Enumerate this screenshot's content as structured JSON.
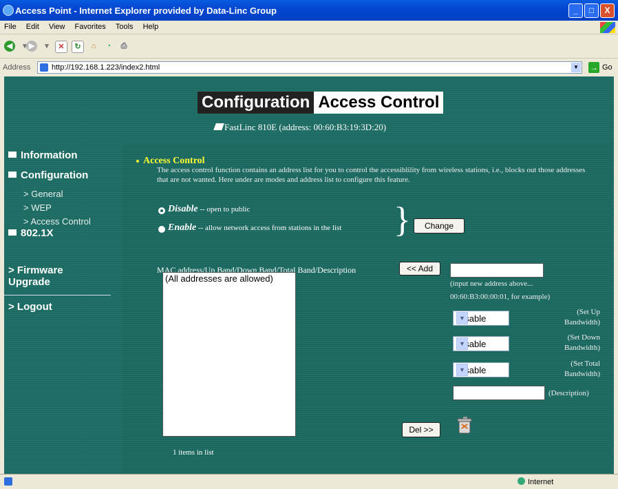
{
  "window": {
    "title": "Access Point - Internet Explorer provided by Data-Linc Group",
    "min": "_",
    "max": "□",
    "close": "X"
  },
  "menu": [
    "File",
    "Edit",
    "View",
    "Favorites",
    "Tools",
    "Help"
  ],
  "address_bar": {
    "label": "Address",
    "url": "http://192.168.1.223/index2.html",
    "go_label": "Go"
  },
  "page": {
    "banner_config": "Configuration",
    "banner_section": "Access Control",
    "device": "FastLinc 810E (address: 00:60:B3:19:3D:20)"
  },
  "sidebar": {
    "information": "Information",
    "configuration": "Configuration",
    "general": "> General",
    "wep": "> WEP",
    "access_control": "> Access Control",
    "dot1x": "802.1X",
    "firmware_1": "> Firmware",
    "firmware_2": "Upgrade",
    "logout": "> Logout"
  },
  "access_control": {
    "title": "Access Control",
    "description": "The access control function contains an address list for you to control the accessiblility from wireless stations, i.e., blocks out those addresses that are not wanted. Here under are modes and address list to configure this feature.",
    "mode_disable_label": "Disable",
    "mode_disable_desc": "-- open to public",
    "mode_enable_label": "Enable",
    "mode_enable_desc": "-- allow network access from stations in the list",
    "selected_mode": "Disable",
    "change_button": "Change",
    "list_label": "MAC address/Up Band/Down Band/Total Band/Description",
    "list_items": [
      "(All addresses are allowed)"
    ],
    "add_button": "<< Add",
    "new_address_value": "",
    "hint_1": "(input new address above...",
    "hint_2": "00:60:B3:00:00:01, for example)",
    "up_bw": {
      "value": "Disable",
      "label_1": "(Set Up",
      "label_2": "Bandwidth)"
    },
    "down_bw": {
      "value": "Disable",
      "label_1": "(Set Down",
      "label_2": "Bandwidth)"
    },
    "total_bw": {
      "value": "Disable",
      "label_1": "(Set Total",
      "label_2": "Bandwidth)"
    },
    "description_value": "",
    "description_label": "(Description)",
    "del_button": "Del >>",
    "count_text": "1 items in list"
  },
  "status": {
    "zone": "Internet"
  },
  "colors": {
    "page_bg": "#1b6b63",
    "section_title": "#ffff33"
  }
}
